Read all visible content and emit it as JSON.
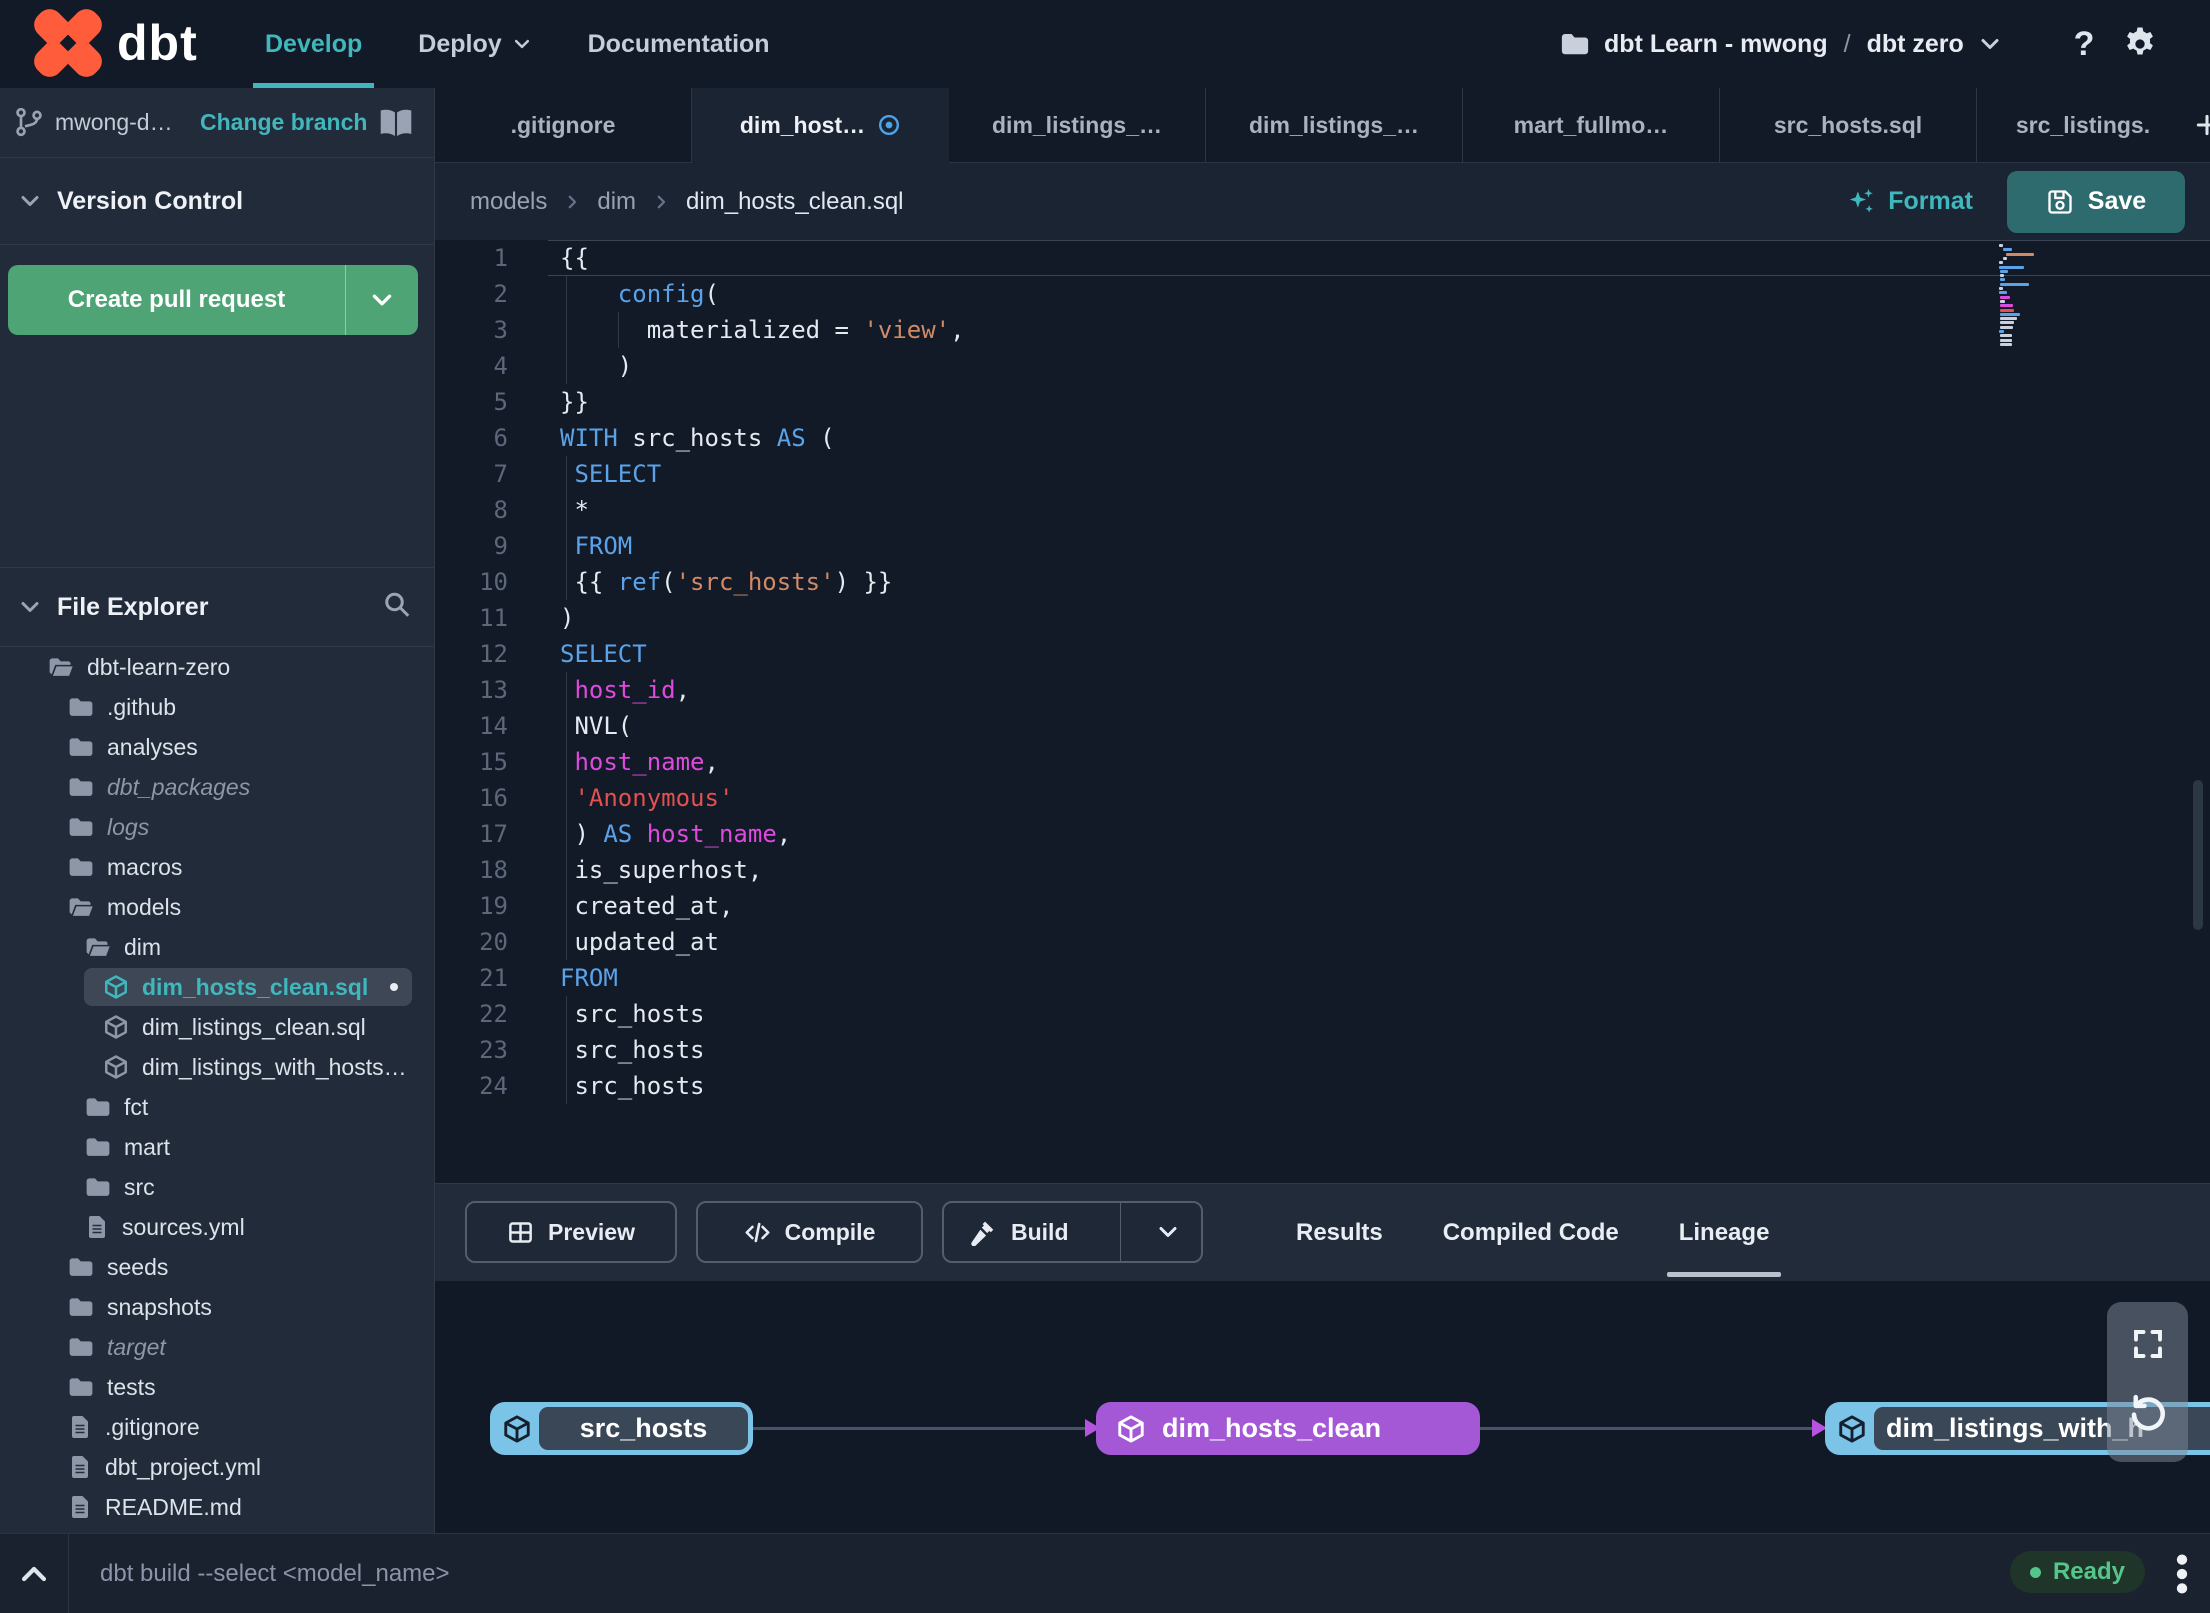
{
  "colors": {
    "accent_teal": "#40b7bc",
    "brand_orange": "#ff5c3c",
    "green_button": "#4ea475",
    "save_teal": "#2e6b6e",
    "keyword_blue": "#5ba3e8",
    "string_orange": "#d08a66",
    "string_red": "#e35050",
    "identifier_magenta": "#de4ade",
    "code_plain": "#e5eaf1",
    "node_blue": "#7cc3e8",
    "node_purple": "#a458d6",
    "arrow_purple": "#b653e0",
    "ready_green": "#55c689"
  },
  "navbar": {
    "logo_text": "dbt",
    "items": [
      {
        "label": "Develop",
        "active": true
      },
      {
        "label": "Deploy",
        "chevron": true
      },
      {
        "label": "Documentation"
      }
    ],
    "project": {
      "account": "dbt Learn - mwong",
      "separator": "/",
      "name": "dbt zero"
    },
    "help_label": "?"
  },
  "branch_bar": {
    "branch": "mwong-d…",
    "change_link": "Change branch"
  },
  "version_control": {
    "title": "Version Control",
    "create_pr": "Create pull request"
  },
  "file_explorer": {
    "title": "File Explorer",
    "tree": [
      {
        "label": "dbt-learn-zero",
        "icon": "folder-open",
        "level": 0
      },
      {
        "label": ".github",
        "icon": "folder",
        "level": 1
      },
      {
        "label": "analyses",
        "icon": "folder",
        "level": 1
      },
      {
        "label": "dbt_packages",
        "icon": "folder",
        "level": 1,
        "muted": true
      },
      {
        "label": "logs",
        "icon": "folder",
        "level": 1,
        "muted": true
      },
      {
        "label": "macros",
        "icon": "folder",
        "level": 1
      },
      {
        "label": "models",
        "icon": "folder-open",
        "level": 1
      },
      {
        "label": "dim",
        "icon": "folder-open",
        "level": 2
      },
      {
        "label": "dim_hosts_clean.sql",
        "icon": "model",
        "level": 3,
        "selected": true,
        "modified": true
      },
      {
        "label": "dim_listings_clean.sql",
        "icon": "model",
        "level": 3
      },
      {
        "label": "dim_listings_with_hosts…",
        "icon": "model",
        "level": 3
      },
      {
        "label": "fct",
        "icon": "folder",
        "level": 2
      },
      {
        "label": "mart",
        "icon": "folder",
        "level": 2
      },
      {
        "label": "src",
        "icon": "folder",
        "level": 2
      },
      {
        "label": "sources.yml",
        "icon": "file",
        "level": 2
      },
      {
        "label": "seeds",
        "icon": "folder",
        "level": 1
      },
      {
        "label": "snapshots",
        "icon": "folder",
        "level": 1
      },
      {
        "label": "target",
        "icon": "folder",
        "level": 1,
        "muted": true
      },
      {
        "label": "tests",
        "icon": "folder",
        "level": 1
      },
      {
        "label": ".gitignore",
        "icon": "file",
        "level": 1
      },
      {
        "label": "dbt_project.yml",
        "icon": "file",
        "level": 1
      },
      {
        "label": "README.md",
        "icon": "file",
        "level": 1
      }
    ]
  },
  "tabs": [
    {
      "label": ".gitignore"
    },
    {
      "label": "dim_host…",
      "active": true,
      "modified": true
    },
    {
      "label": "dim_listings_…"
    },
    {
      "label": "dim_listings_…"
    },
    {
      "label": "mart_fullmo…"
    },
    {
      "label": "src_hosts.sql"
    },
    {
      "label": "src_listings."
    }
  ],
  "editor": {
    "breadcrumb": [
      "models",
      "dim",
      "dim_hosts_clean.sql"
    ],
    "format_label": "Format",
    "save_label": "Save",
    "lines": [
      {
        "n": 1,
        "t": [
          [
            "{{",
            "p"
          ]
        ]
      },
      {
        "n": 2,
        "t": [
          [
            "    ",
            "p"
          ],
          [
            "config",
            "b"
          ],
          [
            "(",
            "p"
          ]
        ]
      },
      {
        "n": 3,
        "t": [
          [
            "      materialized = ",
            "p"
          ],
          [
            "'view'",
            "o"
          ],
          [
            ",",
            "p"
          ]
        ]
      },
      {
        "n": 4,
        "t": [
          [
            "    )",
            "p"
          ]
        ]
      },
      {
        "n": 5,
        "t": [
          [
            "}}",
            "p"
          ]
        ]
      },
      {
        "n": 6,
        "t": [
          [
            "WITH",
            "b"
          ],
          [
            " src_hosts ",
            "p"
          ],
          [
            "AS",
            "b"
          ],
          [
            " (",
            "p"
          ]
        ]
      },
      {
        "n": 7,
        "t": [
          [
            " ",
            "p"
          ],
          [
            "SELECT",
            "b"
          ]
        ]
      },
      {
        "n": 8,
        "t": [
          [
            " *",
            "p"
          ]
        ]
      },
      {
        "n": 9,
        "t": [
          [
            " ",
            "p"
          ],
          [
            "FROM",
            "b"
          ]
        ]
      },
      {
        "n": 10,
        "t": [
          [
            " {{ ",
            "p"
          ],
          [
            "ref",
            "b"
          ],
          [
            "(",
            "p"
          ],
          [
            "'src_hosts'",
            "o"
          ],
          [
            ") }}",
            "p"
          ]
        ]
      },
      {
        "n": 11,
        "t": [
          [
            ")",
            "p"
          ]
        ]
      },
      {
        "n": 12,
        "t": [
          [
            "SELECT",
            "b"
          ]
        ]
      },
      {
        "n": 13,
        "t": [
          [
            " ",
            "p"
          ],
          [
            "host_id",
            "m"
          ],
          [
            ",",
            "p"
          ]
        ]
      },
      {
        "n": 14,
        "t": [
          [
            " NVL(",
            "p"
          ]
        ]
      },
      {
        "n": 15,
        "t": [
          [
            " ",
            "p"
          ],
          [
            "host_name",
            "m"
          ],
          [
            ",",
            "p"
          ]
        ]
      },
      {
        "n": 16,
        "t": [
          [
            " ",
            "p"
          ],
          [
            "'Anonymous'",
            "r"
          ]
        ]
      },
      {
        "n": 17,
        "t": [
          [
            " ) ",
            "p"
          ],
          [
            "AS",
            "b"
          ],
          [
            " ",
            "p"
          ],
          [
            "host_name",
            "m"
          ],
          [
            ",",
            "p"
          ]
        ]
      },
      {
        "n": 18,
        "t": [
          [
            " is_superhost,",
            "p"
          ]
        ]
      },
      {
        "n": 19,
        "t": [
          [
            " created_at,",
            "p"
          ]
        ]
      },
      {
        "n": 20,
        "t": [
          [
            " updated_at",
            "p"
          ]
        ]
      },
      {
        "n": 21,
        "t": [
          [
            "FROM",
            "b"
          ]
        ]
      },
      {
        "n": 22,
        "t": [
          [
            " src_hosts",
            "p"
          ]
        ]
      },
      {
        "n": 23,
        "t": [
          [
            " src_hosts",
            "p"
          ]
        ]
      },
      {
        "n": 24,
        "t": [
          [
            " src_hosts",
            "p"
          ]
        ]
      }
    ]
  },
  "bottom_panel": {
    "buttons": [
      {
        "label": "Preview",
        "icon": "table"
      },
      {
        "label": "Compile",
        "icon": "code"
      },
      {
        "label": "Build",
        "icon": "hammer",
        "split": true
      }
    ],
    "tabs": [
      {
        "label": "Results"
      },
      {
        "label": "Compiled Code"
      },
      {
        "label": "Lineage",
        "active": true
      }
    ],
    "lineage": {
      "nodes": [
        {
          "label": "src_hosts",
          "style": "source"
        },
        {
          "label": "dim_hosts_clean",
          "style": "model"
        },
        {
          "label": "dim_listings_with_h",
          "style": "source"
        }
      ]
    }
  },
  "status_bar": {
    "command": "dbt build --select <model_name>",
    "status": "Ready"
  }
}
